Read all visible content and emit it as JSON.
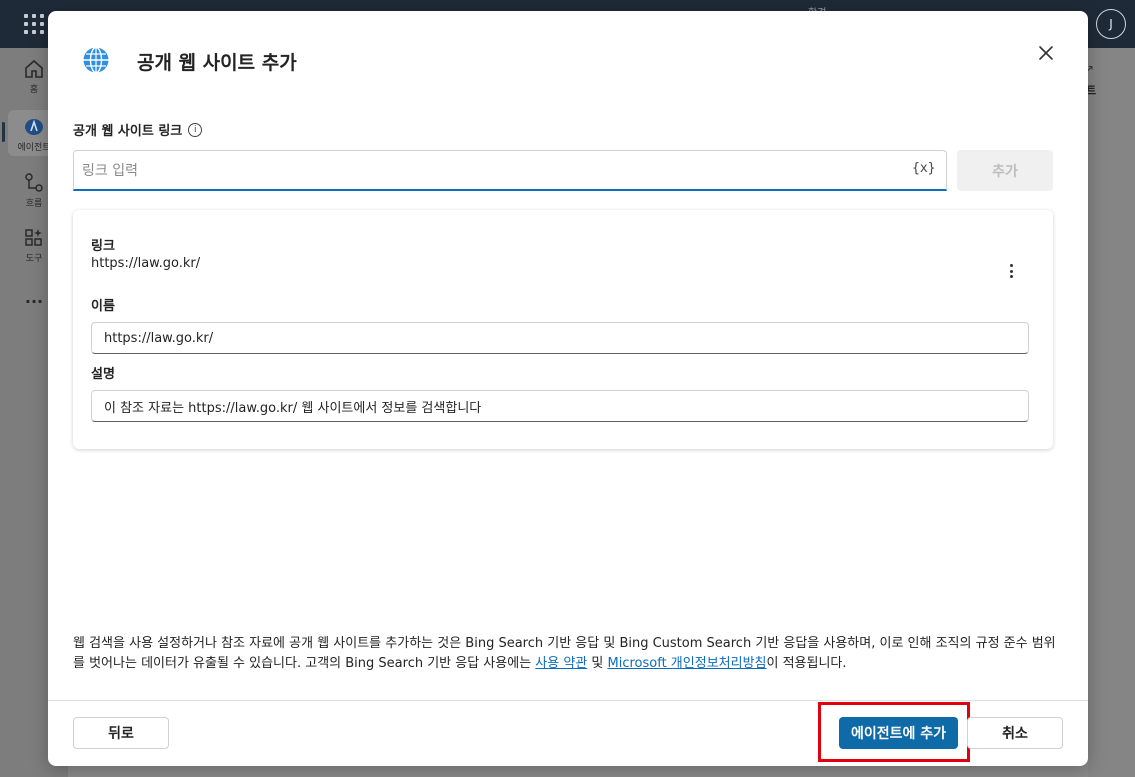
{
  "background": {
    "top_title": "환경",
    "user_initial": "J",
    "rail": [
      {
        "label": "홈",
        "icon": "home-icon"
      },
      {
        "label": "에이전트",
        "icon": "agent-icon"
      },
      {
        "label": "흐름",
        "icon": "flow-icon"
      },
      {
        "label": "도구",
        "icon": "tools-icon"
      },
      {
        "label": "",
        "icon": "more-horizontal-icon"
      }
    ],
    "right_peek_text": "트"
  },
  "dialog": {
    "title": "공개 웹 사이트 추가",
    "icon": "globe-icon",
    "link_field": {
      "label": "공개 웹 사이트 링크",
      "placeholder": "링크 입력",
      "value": "",
      "variable_icon_text": "{x}",
      "add_label": "추가"
    },
    "card": {
      "link_label": "링크",
      "link_value": "https://law.go.kr/",
      "name_label": "이름",
      "name_value": "https://law.go.kr/",
      "description_label": "설명",
      "description_value": "이 참조 자료는 https://law.go.kr/ 웹 사이트에서 정보를 검색합니다"
    },
    "disclaimer": {
      "text_before": "웹 검색을 사용 설정하거나 참조 자료에 공개 웹 사이트를 추가하는 것은 Bing Search 기반 응답 및 Bing Custom Search 기반 응답을 사용하며, 이로 인해 조직의 규정 준수 범위를 벗어나는 데이터가 유출될 수 있습니다. 고객의 Bing Search 기반 응답 사용에는 ",
      "link1": "사용 약관",
      "text_middle": " 및 ",
      "link2": "Microsoft 개인정보처리방침",
      "text_after": "이 적용됩니다."
    },
    "footer": {
      "back_label": "뒤로",
      "add_to_agent_label": "에이전트에 추가",
      "cancel_label": "취소"
    }
  },
  "colors": {
    "primary": "#0f6cbd",
    "highlight": "#e0000f"
  }
}
